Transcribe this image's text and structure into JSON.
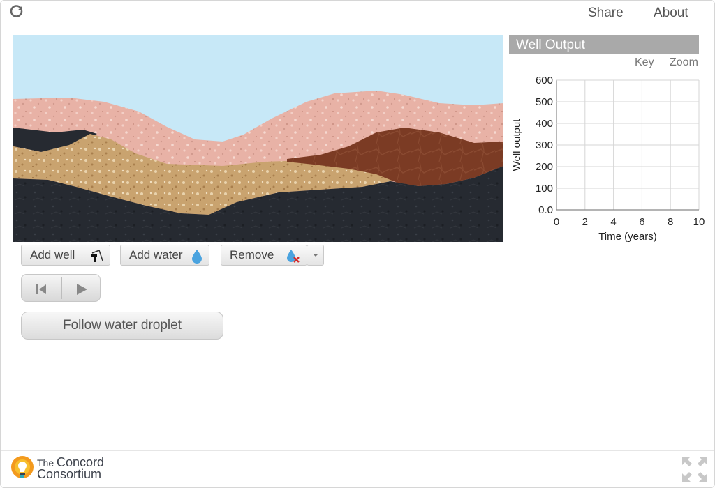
{
  "topbar": {
    "share_label": "Share",
    "about_label": "About"
  },
  "toolbar": {
    "add_well_label": "Add well",
    "add_water_label": "Add water",
    "remove_label": "Remove",
    "follow_label": "Follow water droplet"
  },
  "graph": {
    "title": "Well Output",
    "key_label": "Key",
    "zoom_label": "Zoom"
  },
  "chart_data": {
    "type": "line",
    "title": "Well Output",
    "xlabel": "Time (years)",
    "ylabel": "Well output",
    "xlim": [
      0,
      10
    ],
    "ylim": [
      0,
      600
    ],
    "x_ticks": [
      0,
      2,
      4,
      6,
      8,
      10
    ],
    "y_ticks": [
      0,
      100,
      200,
      300,
      400,
      500,
      600
    ],
    "y_tick_labels": [
      "0.0",
      "100",
      "200",
      "300",
      "400",
      "500",
      "600"
    ],
    "grid": true,
    "series": []
  },
  "footer": {
    "brand_line1": "The",
    "brand_line1b": "Concord",
    "brand_line2": "Consortium"
  },
  "colors": {
    "sky": "#c7e8f7",
    "topsoil": "#e8b2a6",
    "sand": "#c9a36f",
    "bedrock": "#262a31",
    "clay": "#7b3b24"
  }
}
